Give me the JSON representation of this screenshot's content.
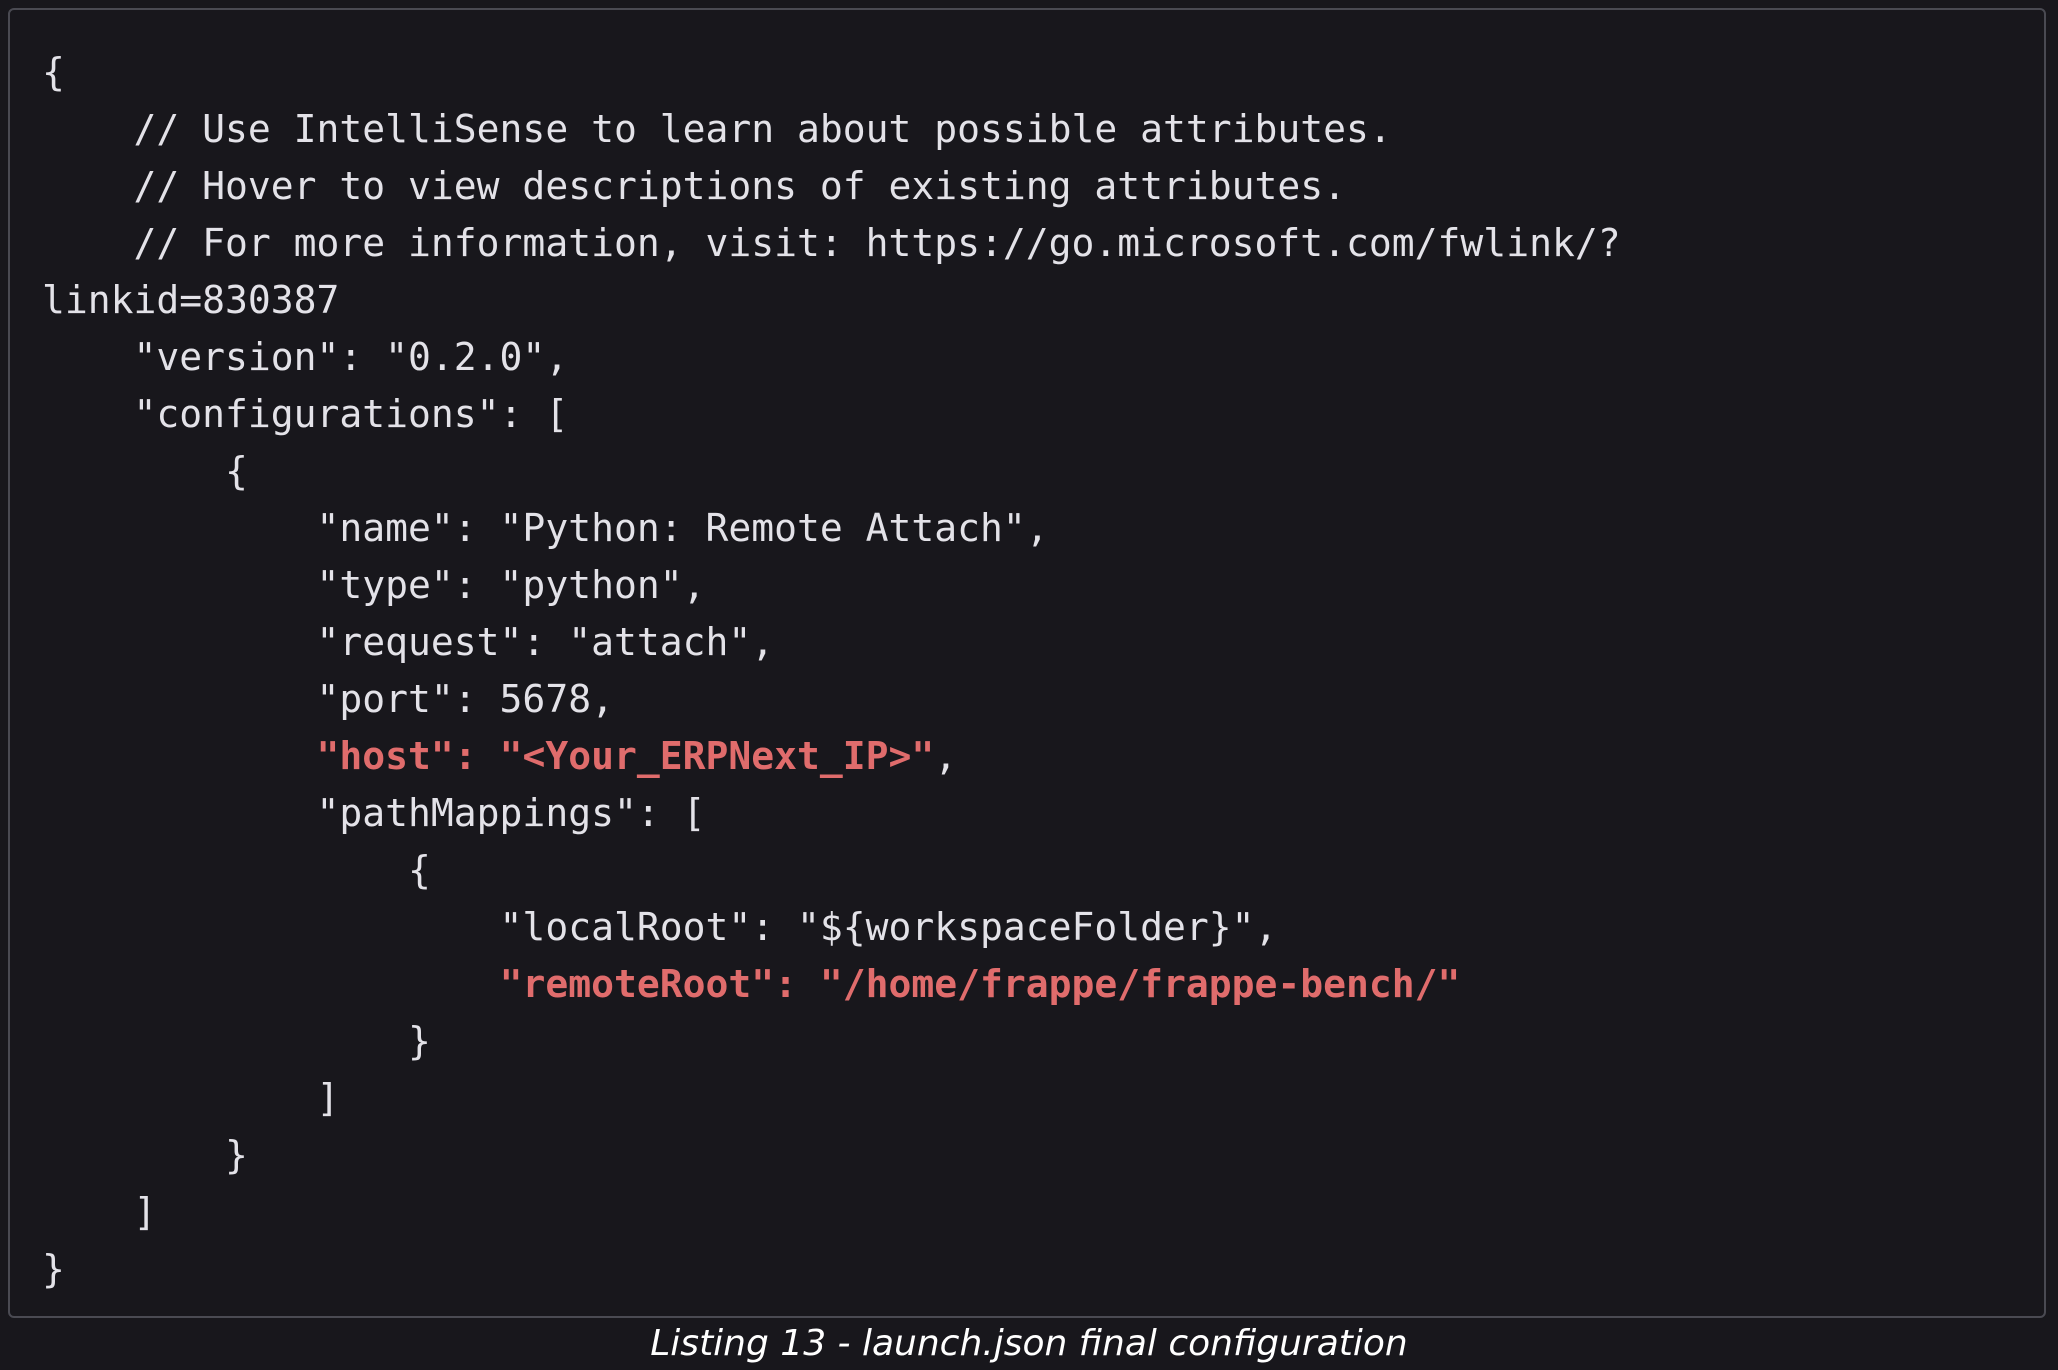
{
  "code": {
    "lines": [
      {
        "text": "{",
        "highlight": false
      },
      {
        "text": "    // Use IntelliSense to learn about possible attributes.",
        "highlight": false
      },
      {
        "text": "    // Hover to view descriptions of existing attributes.",
        "highlight": false
      },
      {
        "text": "    // For more information, visit: https://go.microsoft.com/fwlink/?",
        "highlight": false
      },
      {
        "text": "linkid=830387",
        "highlight": false
      },
      {
        "text": "    \"version\": \"0.2.0\",",
        "highlight": false
      },
      {
        "text": "    \"configurations\": [",
        "highlight": false
      },
      {
        "text": "        {",
        "highlight": false
      },
      {
        "text": "            \"name\": \"Python: Remote Attach\",",
        "highlight": false
      },
      {
        "text": "            \"type\": \"python\",",
        "highlight": false
      },
      {
        "text": "            \"request\": \"attach\",",
        "highlight": false
      },
      {
        "text": "            \"port\": 5678,",
        "highlight": false
      },
      {
        "text": "            \"host\": \"<Your_ERPNext_IP>\",",
        "highlight": true
      },
      {
        "text": "            \"pathMappings\": [",
        "highlight": false
      },
      {
        "text": "                {",
        "highlight": false
      },
      {
        "text": "                    \"localRoot\": \"${workspaceFolder}\",",
        "highlight": false
      },
      {
        "text": "                    \"remoteRoot\": \"/home/frappe/frappe-bench/\"",
        "highlight": true
      },
      {
        "text": "                }",
        "highlight": false
      },
      {
        "text": "            ]",
        "highlight": false
      },
      {
        "text": "        }",
        "highlight": false
      },
      {
        "text": "    ]",
        "highlight": false
      },
      {
        "text": "}",
        "highlight": false
      }
    ]
  },
  "caption": "Listing 13 - launch.json final configuration",
  "colors": {
    "background": "#18171c",
    "text": "#e3e2e8",
    "highlight": "#e06c6c",
    "border": "#4a4a52"
  }
}
